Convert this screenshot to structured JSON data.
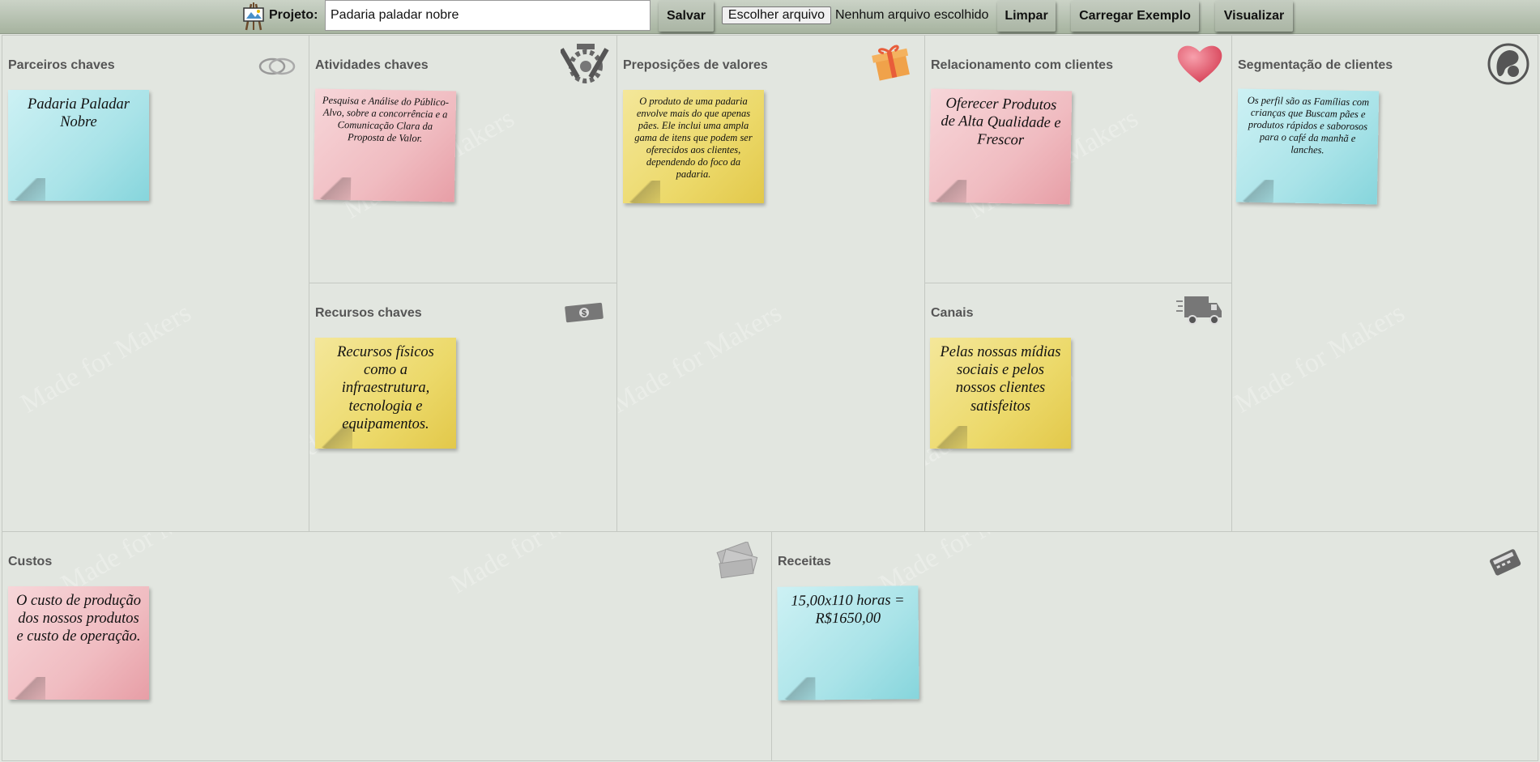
{
  "toolbar": {
    "project_label": "Projeto:",
    "project_value": "Padaria paladar nobre",
    "save_label": "Salvar",
    "file_button_label": "Escolher arquivo",
    "file_status": "Nenhum arquivo escolhido",
    "clear_label": "Limpar",
    "example_label": "Carregar Exemplo",
    "view_label": "Visualizar"
  },
  "sections": {
    "partners": {
      "title": "Parceiros chaves",
      "icon": "rings-icon",
      "notes": [
        {
          "text": "Padaria Paladar Nobre",
          "color": "blue"
        }
      ]
    },
    "activities": {
      "title": "Atividades chaves",
      "icon": "tools-icon",
      "notes": [
        {
          "text": "Pesquisa e Análise do Público-Alvo, sobre a concorrência e a Comunicação Clara da Proposta de Valor.",
          "color": "pink"
        }
      ]
    },
    "resources": {
      "title": "Recursos chaves",
      "icon": "money-icon",
      "notes": [
        {
          "text": "Recursos físicos como a infraestrutura, tecnologia e equipamentos.",
          "color": "yellow"
        }
      ]
    },
    "value": {
      "title": "Preposições de valores",
      "icon": "gift-icon",
      "notes": [
        {
          "text": "O produto de uma padaria envolve mais do que apenas pães. Ele inclui uma ampla gama de itens que podem ser oferecidos aos clientes, dependendo do foco da padaria.",
          "color": "yellow"
        }
      ]
    },
    "relationships": {
      "title": "Relacionamento com clientes",
      "icon": "heart-icon",
      "notes": [
        {
          "text": "Oferecer Produtos de Alta Qualidade e Frescor",
          "color": "pink"
        }
      ]
    },
    "channels": {
      "title": "Canais",
      "icon": "truck-icon",
      "notes": [
        {
          "text": "Pelas nossas mídias sociais e pelos nossos clientes satisfeitos",
          "color": "yellow"
        }
      ]
    },
    "segments": {
      "title": "Segmentação de clientes",
      "icon": "mother-child-icon",
      "notes": [
        {
          "text": "Os perfil são as Famílias com crianças que Buscam pães e produtos rápidos e saborosos para o café da manhã e lanches.",
          "color": "blue"
        }
      ]
    },
    "costs": {
      "title": "Custos",
      "icon": "cash-bills-icon",
      "notes": [
        {
          "text": "O custo de produção dos nossos produtos e custo de operação.",
          "color": "pink"
        }
      ]
    },
    "revenue": {
      "title": "Receitas",
      "icon": "card-machine-icon",
      "notes": [
        {
          "text": "15,00x110 horas = R$1650,00",
          "color": "blue"
        }
      ]
    }
  },
  "colors": {
    "toolbar": "#a6b39f",
    "canvas": "#e2e6e0",
    "section_title": "#555555",
    "note_blue": "#a9e3e8",
    "note_pink": "#f0bcc1",
    "note_yellow": "#ecd96a"
  }
}
